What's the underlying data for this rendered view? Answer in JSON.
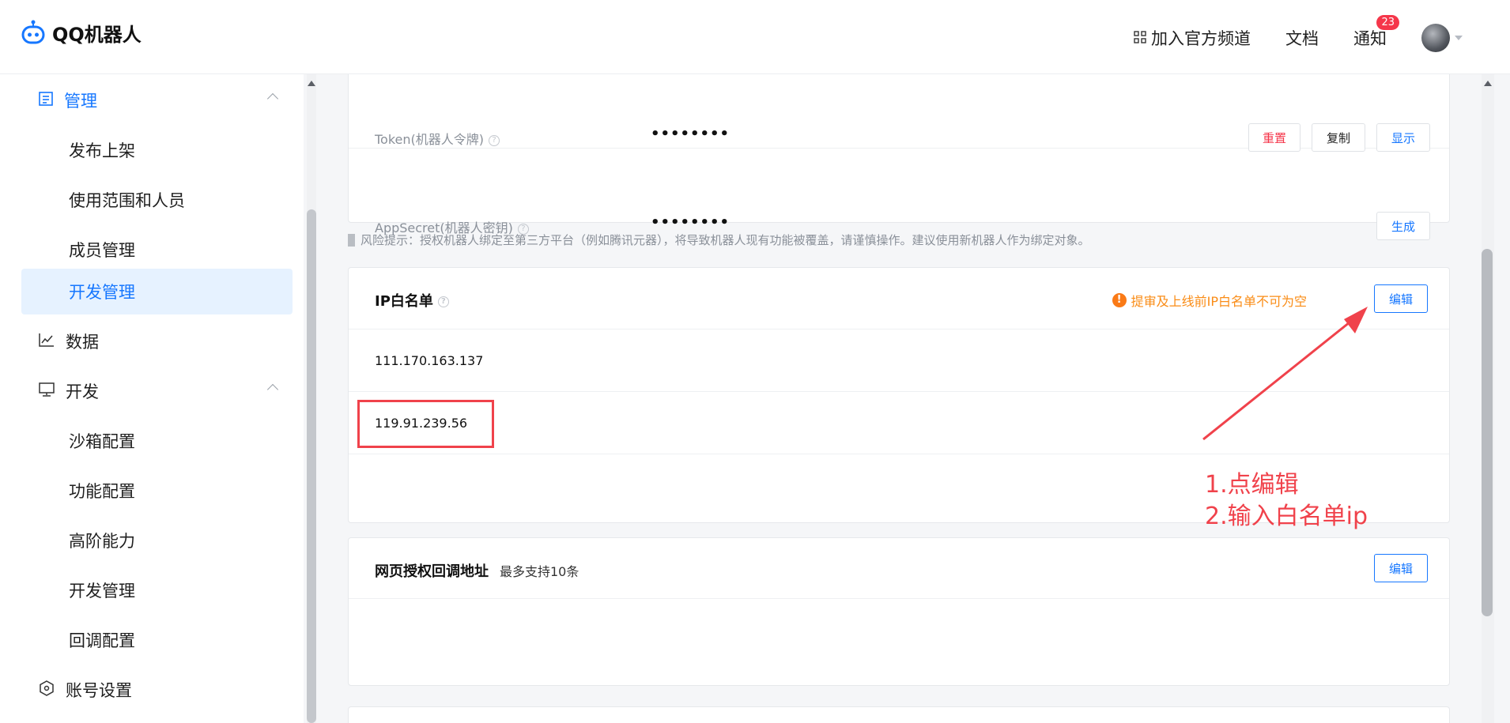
{
  "header": {
    "app_name": "QQ机器人",
    "join_channel": "加入官方频道",
    "docs": "文档",
    "notice": "通知",
    "notice_count": "23"
  },
  "sidebar": {
    "manage": "管理",
    "publish": "发布上架",
    "scope": "使用范围和人员",
    "members": "成员管理",
    "dev_manage": "开发管理",
    "data": "数据",
    "develop": "开发",
    "sandbox": "沙箱配置",
    "features": "功能配置",
    "advanced": "高阶能力",
    "dev_manage2": "开发管理",
    "callback": "回调配置",
    "account": "账号设置"
  },
  "credentials": {
    "token_label": "Token(机器人令牌)",
    "token_value": "••••••••",
    "reset": "重置",
    "copy": "复制",
    "show": "显示",
    "secret_label": "AppSecret(机器人密钥)",
    "secret_value": "••••••••",
    "generate": "生成"
  },
  "risk_tip": "风险提示：授权机器人绑定至第三方平台（例如腾讯元器），将导致机器人现有功能被覆盖，请谨慎操作。建议使用新机器人作为绑定对象。",
  "ip_whitelist": {
    "title": "IP白名单",
    "warning": "提审及上线前IP白名单不可为空",
    "edit": "编辑",
    "ips": [
      "111.170.163.137",
      "119.91.239.56"
    ]
  },
  "callback_card": {
    "title": "网页授权回调地址",
    "subtitle": "最多支持10条",
    "edit": "编辑"
  },
  "annotation": {
    "line1": "1.点编辑",
    "line2": "2.输入白名单ip"
  },
  "colors": {
    "accent": "#1677ff",
    "danger": "#f5364a",
    "warning": "#fa8c16",
    "annotation": "#f0424b"
  }
}
